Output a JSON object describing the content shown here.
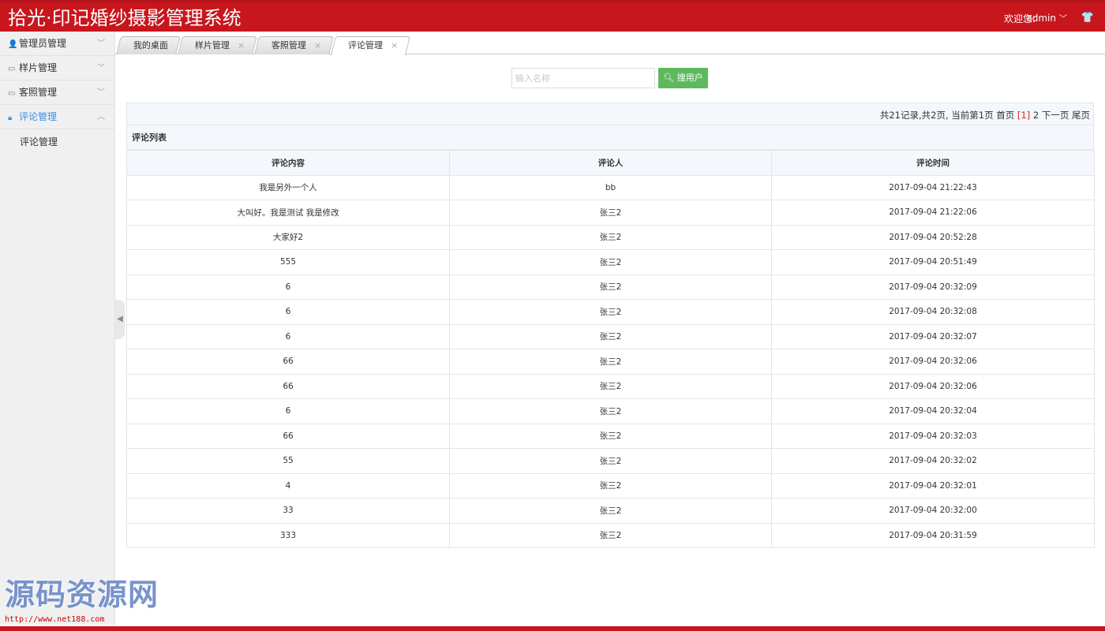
{
  "header": {
    "title": "拾光·印记婚纱摄影管理系统",
    "welcome": "欢迎您:",
    "username": "admin",
    "user_chevron": "chevron-down-icon",
    "shirt_icon": "shirt-icon"
  },
  "sidebar": {
    "items": [
      {
        "label": "管理员管理",
        "icon": "user-icon",
        "expanded": false
      },
      {
        "label": "样片管理",
        "icon": "image-icon",
        "expanded": false
      },
      {
        "label": "客照管理",
        "icon": "image-icon",
        "expanded": false
      },
      {
        "label": "评论管理",
        "icon": "lock-icon",
        "expanded": true
      }
    ],
    "submenu": [
      {
        "label": "评论管理"
      }
    ],
    "active_color": "#3a8ee6"
  },
  "tabs": [
    {
      "label": "我的桌面",
      "closable": false
    },
    {
      "label": "样片管理",
      "closable": true,
      "close": "×"
    },
    {
      "label": "客照管理",
      "closable": true,
      "close": "×"
    },
    {
      "label": "评论管理",
      "closable": true,
      "close": "×",
      "active": true
    }
  ],
  "search": {
    "placeholder": "输入名称",
    "value": "",
    "button_label": "搜用户",
    "button_icon": "search-icon",
    "button_color": "#5eb95e"
  },
  "pager": {
    "summary": "共21记录,共2页, 当前第1页",
    "first": "首页",
    "current": "[1]",
    "page2": "2",
    "next": "下一页",
    "last": "尾页"
  },
  "list": {
    "title": "评论列表",
    "columns": [
      "评论内容",
      "评论人",
      "评论时间"
    ],
    "rows": [
      [
        "我是另外一个人",
        "bb",
        "2017-09-04 21:22:43"
      ],
      [
        "大叫好。我是测试 我是修改",
        "张三2",
        "2017-09-04 21:22:06"
      ],
      [
        "大家好2",
        "张三2",
        "2017-09-04 20:52:28"
      ],
      [
        "555",
        "张三2",
        "2017-09-04 20:51:49"
      ],
      [
        "6",
        "张三2",
        "2017-09-04 20:32:09"
      ],
      [
        "6",
        "张三2",
        "2017-09-04 20:32:08"
      ],
      [
        "6",
        "张三2",
        "2017-09-04 20:32:07"
      ],
      [
        "66",
        "张三2",
        "2017-09-04 20:32:06"
      ],
      [
        "66",
        "张三2",
        "2017-09-04 20:32:06"
      ],
      [
        "6",
        "张三2",
        "2017-09-04 20:32:04"
      ],
      [
        "66",
        "张三2",
        "2017-09-04 20:32:03"
      ],
      [
        "55",
        "张三2",
        "2017-09-04 20:32:02"
      ],
      [
        "4",
        "张三2",
        "2017-09-04 20:32:01"
      ],
      [
        "33",
        "张三2",
        "2017-09-04 20:32:00"
      ],
      [
        "333",
        "张三2",
        "2017-09-04 20:31:59"
      ]
    ]
  },
  "watermark": {
    "text": "源码资源网",
    "url": "http://www.net188.com"
  },
  "colors": {
    "brand_red": "#c8161d",
    "pager_current": "#d9252b"
  }
}
